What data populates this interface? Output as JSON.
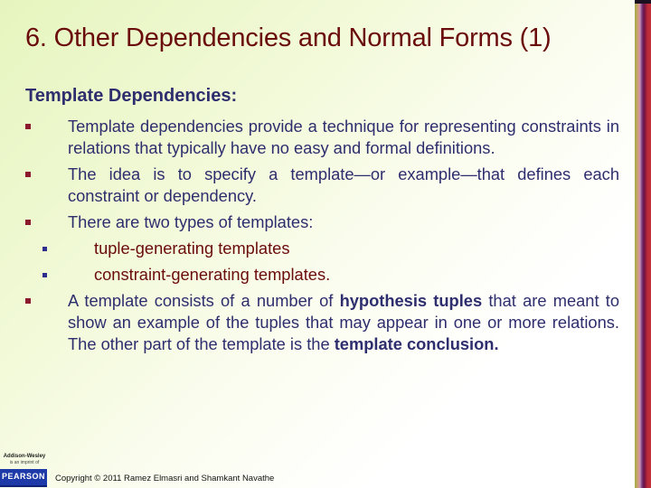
{
  "slide": {
    "title": "6. Other Dependencies and Normal Forms (1)",
    "subheading": "Template Dependencies:",
    "bullets": [
      {
        "text": "Template dependencies provide a technique for representing constraints in relations that typically have no easy and formal definitions."
      },
      {
        "text": "The idea is to specify a template—or example—that defines each constraint or dependency."
      },
      {
        "text": "There are two types of templates:"
      }
    ],
    "sub_bullets": [
      {
        "text": "tuple-generating templates"
      },
      {
        "text": "constraint-generating templates."
      }
    ],
    "last_bullet": {
      "part1": "A template consists of a number of ",
      "bold1": "hypothesis tuples",
      "part2": " that are meant to show an example of the tuples that may appear in one or more relations. The other part of the template is the ",
      "bold2": "template conclusion."
    }
  },
  "footer": {
    "publisher_line1": "Addison-Wesley",
    "publisher_line2": "is an imprint of",
    "logo_text": "PEARSON",
    "copyright": "Copyright © 2011 Ramez Elmasri and Shamkant Navathe"
  },
  "colors": {
    "title": "#6b0c0c",
    "body_text": "#2e2e6e",
    "bullet": "#8b1a2e",
    "sub_bullet": "#2e2e8e",
    "pearson_blue": "#1e3aa8"
  }
}
